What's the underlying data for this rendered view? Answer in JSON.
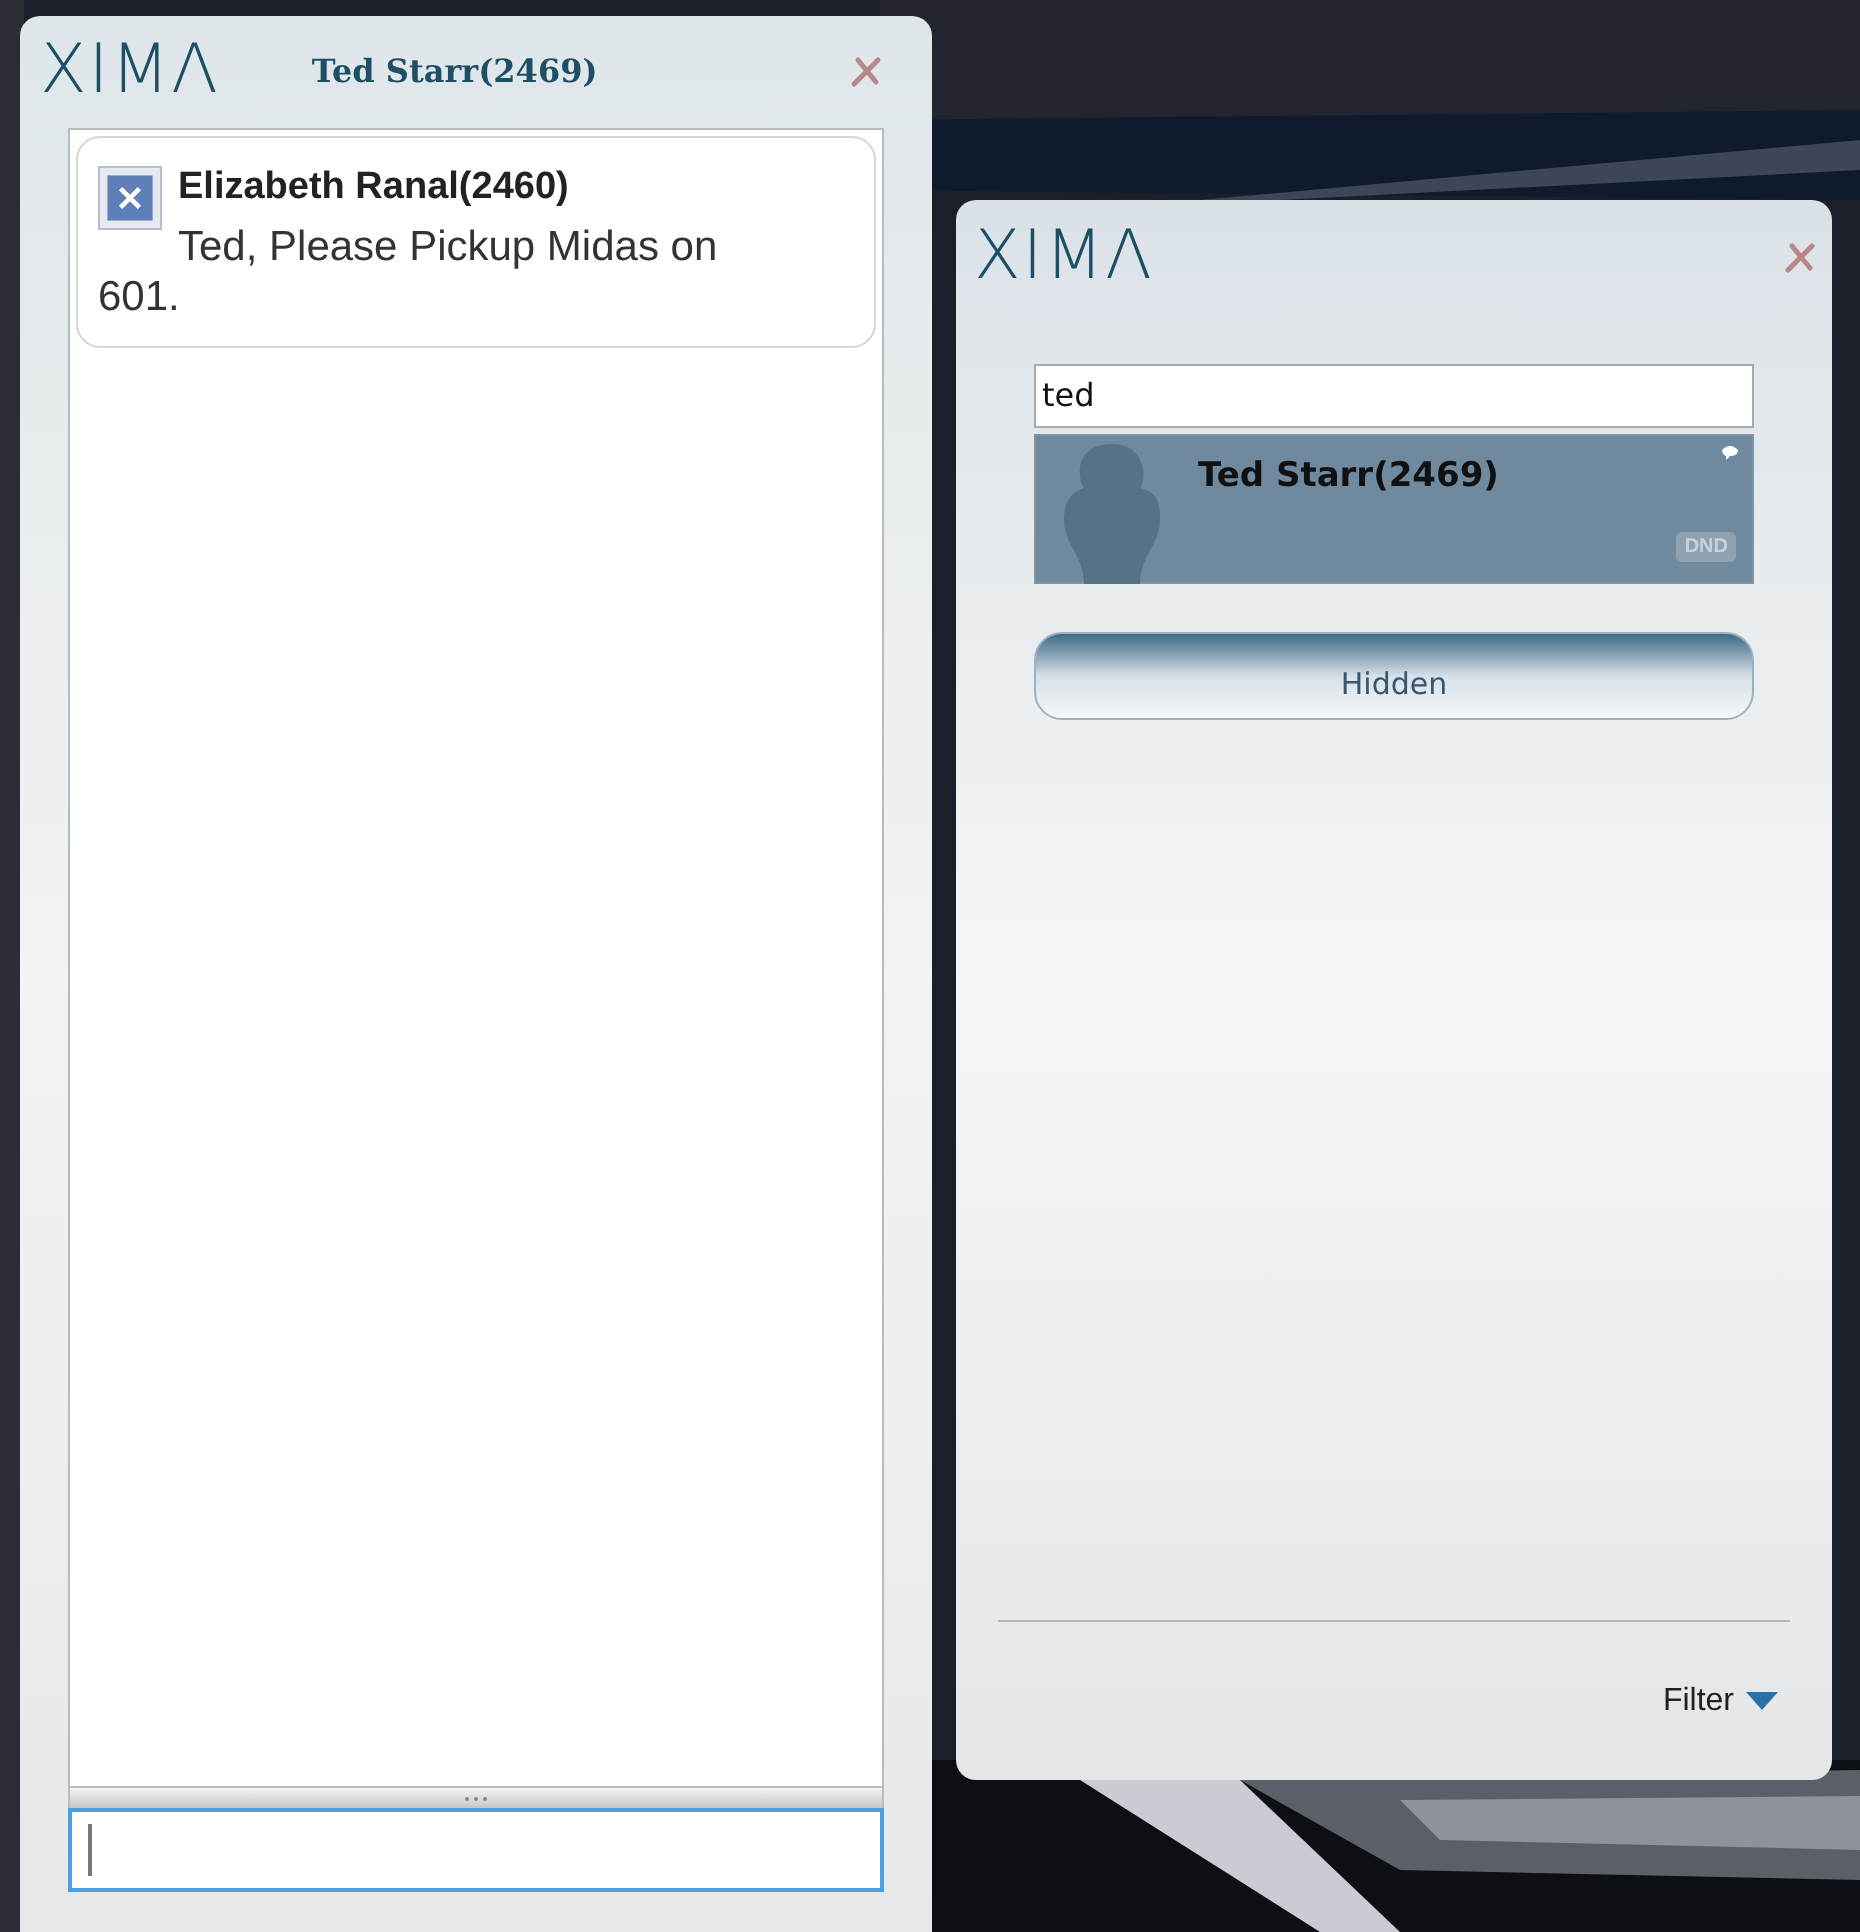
{
  "chat_window": {
    "logo": "XIMΛ",
    "title": "Ted Starr(2469)",
    "messages": [
      {
        "sender": "Elizabeth Ranal(2460)",
        "text": "Ted, Please Pickup Midas on 601."
      }
    ],
    "input": {
      "focused": true
    }
  },
  "contacts_window": {
    "logo": "XIMΛ",
    "search": {
      "value": "ted"
    },
    "contacts": [
      {
        "name": "Ted Starr(2469)",
        "status": "DND",
        "selected": true
      }
    ],
    "group_button": "Hidden",
    "filter": "Filter"
  }
}
